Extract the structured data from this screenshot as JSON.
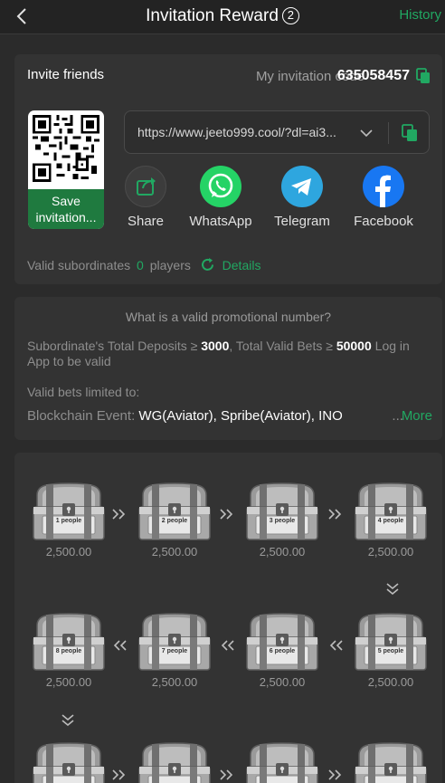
{
  "header": {
    "title": "Invitation Reward",
    "badge": "2",
    "history": "History"
  },
  "invite": {
    "title": "Invite friends",
    "code_label": "My invitation code",
    "code_value": "635058457",
    "qr_save_label": "Save invitation...",
    "link": "https://www.jeeto999.cool/?dl=ai3..."
  },
  "share": [
    {
      "label": "Share",
      "icon": "share-icon",
      "color": "#3c3c3c"
    },
    {
      "label": "WhatsApp",
      "icon": "whatsapp-icon",
      "color": "#25d366"
    },
    {
      "label": "Telegram",
      "icon": "telegram-icon",
      "color": "#2ea6df"
    },
    {
      "label": "Facebook",
      "icon": "facebook-icon",
      "color": "#1877f2"
    }
  ],
  "valid": {
    "label": "Valid subordinates",
    "count": "0",
    "unit": "players",
    "details": "Details"
  },
  "promo": {
    "question": "What is a valid promotional number?",
    "deposits_label": "Subordinate's Total Deposits ≥",
    "deposits_value": "3000",
    "bets_label": ",  Total Valid Bets ≥",
    "bets_value": "50000",
    "tail": " Log in App to be valid",
    "limited": "Valid bets limited to:",
    "events_label": "Blockchain Event:",
    "events_value": "WG(Aviator),  Spribe(Aviator),  INO",
    "events_dots": "...",
    "more": "More"
  },
  "rewards": [
    {
      "people": "1 people",
      "amount": "2,500.00"
    },
    {
      "people": "2 people",
      "amount": "2,500.00"
    },
    {
      "people": "3 people",
      "amount": "2,500.00"
    },
    {
      "people": "4 people",
      "amount": "2,500.00"
    },
    {
      "people": "8 people",
      "amount": "2,500.00"
    },
    {
      "people": "7 people",
      "amount": "2,500.00"
    },
    {
      "people": "6 people",
      "amount": "2,500.00"
    },
    {
      "people": "5 people",
      "amount": "2,500.00"
    },
    {
      "people": "",
      "amount": ""
    },
    {
      "people": "",
      "amount": ""
    },
    {
      "people": "",
      "amount": ""
    },
    {
      "people": "",
      "amount": ""
    }
  ],
  "colors": {
    "accent": "#21a862",
    "card": "#333333",
    "background": "#2b2b2b"
  }
}
